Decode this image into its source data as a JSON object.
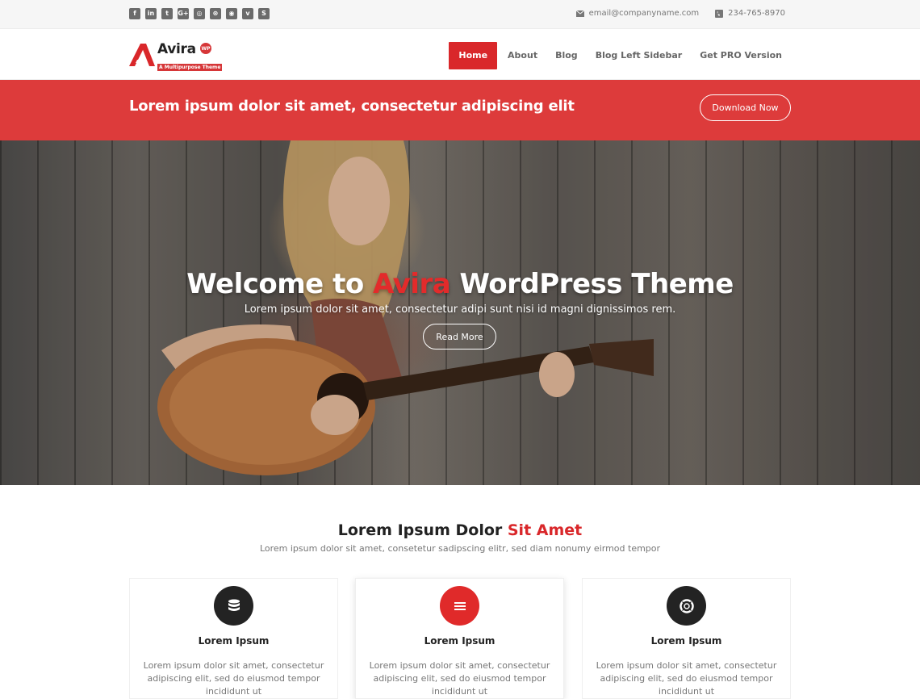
{
  "topbar": {
    "social_icons": [
      "facebook-icon",
      "linkedin-icon",
      "twitter-icon",
      "google-plus-icon",
      "instagram-icon",
      "dribbble-icon",
      "github-icon",
      "vine-icon",
      "skype-icon"
    ],
    "email": "email@companyname.com",
    "phone": "234-765-8970"
  },
  "brand": {
    "name": "Avira",
    "badge": "WP",
    "tagline": "A Multipurpose Theme"
  },
  "nav": {
    "items": [
      "Home",
      "About",
      "Blog",
      "Blog Left Sidebar",
      "Get PRO Version"
    ],
    "active": "Home"
  },
  "banner": {
    "text": "Lorem ipsum dolor sit amet, consectetur adipiscing elit",
    "button": "Download Now"
  },
  "hero": {
    "title_pre": "Welcome to ",
    "title_accent": "Avira",
    "title_post": " WordPress Theme",
    "subtitle": "Lorem ipsum dolor sit amet, consectetur adipi sunt nisi id magni dignissimos rem.",
    "button": "Read More"
  },
  "services": {
    "title_pre": "Lorem Ipsum Dolor ",
    "title_accent": "Sit Amet",
    "subtitle": "Lorem ipsum dolor sit amet, consetetur sadipscing elitr, sed diam nonumy eirmod tempor",
    "cards": [
      {
        "icon": "database-icon",
        "title": "Lorem Ipsum",
        "text": "Lorem ipsum dolor sit amet, consectetur adipiscing elit, sed do eiusmod tempor incididunt ut"
      },
      {
        "icon": "menu-icon",
        "title": "Lorem Ipsum",
        "text": "Lorem ipsum dolor sit amet, consectetur adipiscing elit, sed do eiusmod tempor incididunt ut"
      },
      {
        "icon": "lifebuoy-icon",
        "title": "Lorem Ipsum",
        "text": "Lorem ipsum dolor sit amet, consectetur adipiscing elit, sed do eiusmod tempor incididunt ut"
      }
    ]
  },
  "colors": {
    "accent": "#d9272a",
    "banner": "#dd3b3b",
    "dark": "#232323"
  }
}
